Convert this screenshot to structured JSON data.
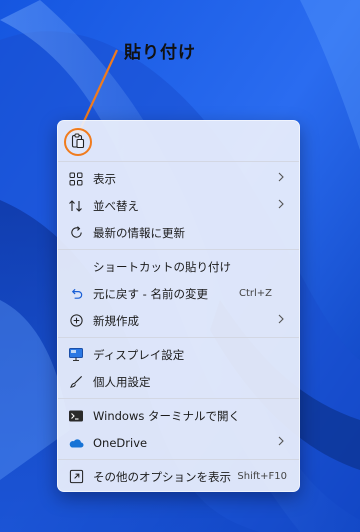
{
  "annotation": {
    "label": "貼り付け"
  },
  "context_menu": {
    "top_actions": [
      {
        "icon": "paste-icon"
      }
    ],
    "sections": [
      [
        {
          "label": "表示",
          "icon": "view-grid-icon",
          "submenu": true
        },
        {
          "label": "並べ替え",
          "icon": "sort-icon",
          "submenu": true
        },
        {
          "label": "最新の情報に更新",
          "icon": "refresh-icon"
        }
      ],
      [
        {
          "label": "ショートカットの貼り付け",
          "icon": ""
        },
        {
          "label": "元に戻す - 名前の変更",
          "icon": "undo-icon",
          "shortcut": "Ctrl+Z"
        },
        {
          "label": "新規作成",
          "icon": "new-icon",
          "submenu": true
        }
      ],
      [
        {
          "label": "ディスプレイ設定",
          "icon": "display-icon"
        },
        {
          "label": "個人用設定",
          "icon": "personalize-brush-icon"
        }
      ],
      [
        {
          "label": "Windows ターミナルで開く",
          "icon": "terminal-icon"
        },
        {
          "label": "OneDrive",
          "icon": "onedrive-cloud-icon",
          "submenu": true
        }
      ],
      [
        {
          "label": "その他のオプションを表示",
          "icon": "more-options-icon",
          "shortcut": "Shift+F10"
        }
      ]
    ]
  }
}
